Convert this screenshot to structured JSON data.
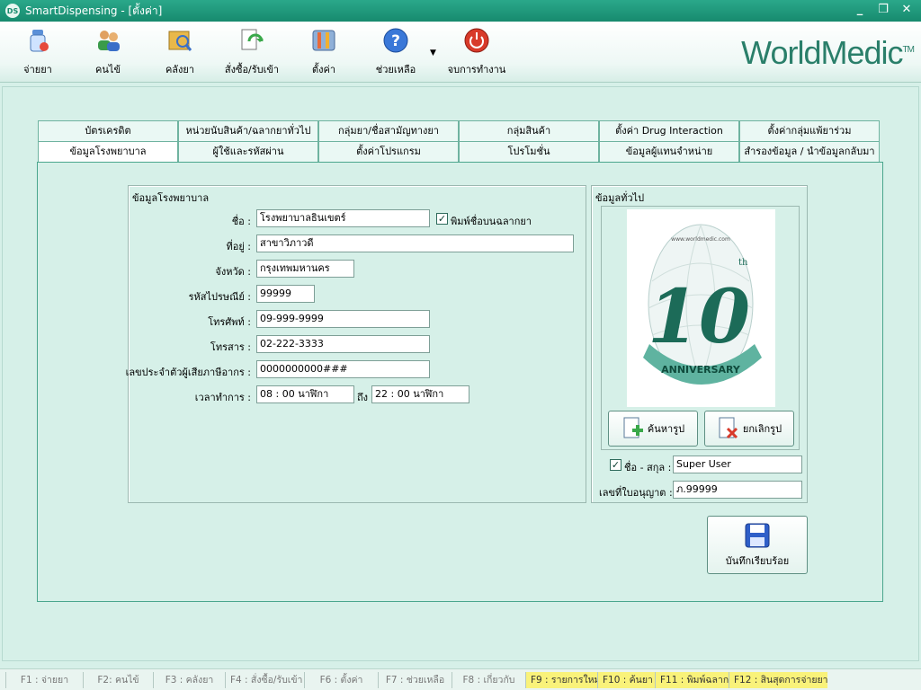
{
  "window": {
    "title": "SmartDispensing - [ตั้งค่า]",
    "app_icon_text": "DS",
    "minimize": "_",
    "restore": "❐",
    "close": "✕"
  },
  "toolbar": {
    "items": [
      {
        "label": "จ่ายยา",
        "icon": "dispense-icon"
      },
      {
        "label": "คนไข้",
        "icon": "patients-icon"
      },
      {
        "label": "คลังยา",
        "icon": "inventory-icon"
      },
      {
        "label": "สั่งซื้อ/รับเข้า",
        "icon": "order-receive-icon"
      },
      {
        "label": "ตั้งค่า",
        "icon": "settings-icon"
      },
      {
        "label": "ช่วยเหลือ",
        "icon": "help-icon"
      },
      {
        "label": "จบการทำงาน",
        "icon": "exit-icon"
      }
    ],
    "brand": "WorldMedic",
    "brand_tm": "TM"
  },
  "tabs": {
    "row1": [
      "บัตรเครดิต",
      "หน่วยนับสินค้า/ฉลากยาทั่วไป",
      "กลุ่มยา/ชื่อสามัญทางยา",
      "กลุ่มสินค้า",
      "ตั้งค่า Drug Interaction",
      "ตั้งค่ากลุ่มแพ้ยาร่วม"
    ],
    "row2": [
      "ข้อมูลโรงพยาบาล",
      "ผู้ใช้และรหัสผ่าน",
      "ตั้งค่าโปรแกรม",
      "โปรโมชั่น",
      "ข้อมูลผู้แทนจำหน่าย",
      "สำรองข้อมูล / นำข้อมูลกลับมา"
    ],
    "active": "ข้อมูลโรงพยาบาล"
  },
  "hospital": {
    "group_title": "ข้อมูลโรงพยาบาล",
    "name_label": "ชื่อ :",
    "name": "โรงพยาบาลธินเขตร์",
    "print_label_checkbox": "พิมพ์ชื่อบนฉลากยา",
    "print_label_checked": true,
    "address_label": "ที่อยู่ :",
    "address": "สาขาวิภาวดี",
    "province_label": "จังหวัด :",
    "province": "กรุงเทพมหานคร",
    "postcode_label": "รหัสไปรษณีย์ :",
    "postcode": "99999",
    "phone_label": "โทรศัพท์ :",
    "phone": "09-999-9999",
    "fax_label": "โทรสาร :",
    "fax": "02-222-3333",
    "taxid_label": "เลขประจำตัวผู้เสียภาษีอากร :",
    "taxid": "0000000000###",
    "hours_label": "เวลาทำการ :",
    "hours_from": "08 : 00 นาฬิกา",
    "hours_to_label": "ถึง",
    "hours_to": "22 : 00 นาฬิกา"
  },
  "general": {
    "group_title": "ข้อมูลทั่วไป",
    "logo_text": "10",
    "logo_th": "th",
    "logo_ribbon": "ANNIVERSARY",
    "logo_arc": "www.worldmedic.com",
    "browse_button": "ค้นหารูป",
    "cancel_button": "ยกเลิกรูป",
    "fullname_checkbox": "ชื่อ - สกุล :",
    "fullname_checked": true,
    "fullname": "Super User",
    "license_label": "เลขที่ใบอนุญาต :",
    "license": "ภ.99999"
  },
  "save_button": "บันทึกเรียบร้อย",
  "statusbar": [
    {
      "label": "F1 : จ่ายยา",
      "hl": false
    },
    {
      "label": "F2: คนไข้",
      "hl": false
    },
    {
      "label": "F3 : คลังยา",
      "hl": false
    },
    {
      "label": "F4 : สั่งซื้อ/รับเข้า",
      "hl": false
    },
    {
      "label": "F6 : ตั้งค่า",
      "hl": false
    },
    {
      "label": "F7 : ช่วยเหลือ",
      "hl": false
    },
    {
      "label": "F8 : เกี่ยวกับ",
      "hl": false
    },
    {
      "label": "F9 : รายการใหม่",
      "hl": true
    },
    {
      "label": "F10 : ค้นยา",
      "hl": true
    },
    {
      "label": "F11 : พิมพ์ฉลาก",
      "hl": true
    },
    {
      "label": "F12 : สินสุดการจ่ายยา",
      "hl": true
    }
  ],
  "colors": {
    "accent": "#178a6e",
    "highlight": "#f9f27a",
    "panel": "#d6f0e8"
  }
}
